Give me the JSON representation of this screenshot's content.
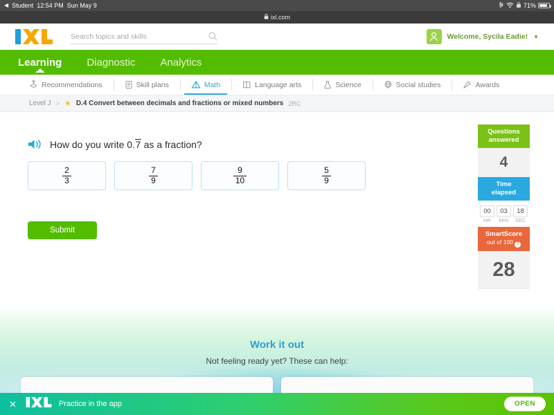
{
  "statusbar": {
    "back_glyph": "◀",
    "app_label": "Student",
    "time": "12:54 PM",
    "date": "Sun May 9",
    "bluetooth_icon": "bluetooth-icon",
    "wifi_icon": "wifi-icon",
    "lock_rotation_icon": "rotation-lock-icon",
    "battery_percent": "71%"
  },
  "browser": {
    "lock_glyph": "🔒",
    "url": "ixl.com"
  },
  "header": {
    "logo_text": "IXL",
    "logo_colors": {
      "i": "#1f9fda",
      "xl": "#f5a800"
    },
    "search": {
      "placeholder": "Search topics and skills",
      "value": "",
      "icon": "search-icon"
    },
    "user": {
      "avatar_icon": "user-avatar-icon",
      "greeting": "Welcome, Sycila Eadie!",
      "caret": "▼"
    }
  },
  "greennav": {
    "color": "#54bc00",
    "items": [
      {
        "label": "Learning",
        "active": true
      },
      {
        "label": "Diagnostic",
        "active": false
      },
      {
        "label": "Analytics",
        "active": false
      }
    ]
  },
  "subjects": {
    "accent": "#2aa8e0",
    "items": [
      {
        "label": "Recommendations",
        "icon": "recommendations-icon",
        "active": false
      },
      {
        "label": "Skill plans",
        "icon": "skill-plans-icon",
        "active": false
      },
      {
        "label": "Math",
        "icon": "math-icon",
        "active": true
      },
      {
        "label": "Language arts",
        "icon": "language-arts-icon",
        "active": false
      },
      {
        "label": "Science",
        "icon": "science-icon",
        "active": false
      },
      {
        "label": "Social studies",
        "icon": "social-studies-icon",
        "active": false
      },
      {
        "label": "Awards",
        "icon": "awards-icon",
        "active": false
      }
    ]
  },
  "breadcrumb": {
    "level": "Level J",
    "separator": ">",
    "star_icon": "star-icon",
    "skill_title": "D.4 Convert between decimals and fractions or mixed numbers",
    "skill_code": "2RC"
  },
  "question": {
    "speaker_icon": "speaker-icon",
    "prefix": "How do you write 0.",
    "repeating_digit": "7",
    "suffix": " as a fraction?",
    "choices": [
      {
        "numerator": "2",
        "denominator": "3",
        "selected": false
      },
      {
        "numerator": "7",
        "denominator": "9",
        "selected": false
      },
      {
        "numerator": "9",
        "denominator": "10",
        "selected": false
      },
      {
        "numerator": "5",
        "denominator": "9",
        "selected": false
      }
    ],
    "submit_label": "Submit"
  },
  "panel": {
    "questions": {
      "title_line1": "Questions",
      "title_line2": "answered",
      "value": "4",
      "color": "#7cc117"
    },
    "time": {
      "title_line1": "Time",
      "title_line2": "elapsed",
      "color": "#29a9e0",
      "hr": "00",
      "min": "03",
      "sec": "18",
      "hr_label": "HR",
      "min_label": "MIN",
      "sec_label": "SEC"
    },
    "smartscore": {
      "title": "SmartScore",
      "subtitle": "out of 100",
      "help_glyph": "?",
      "value": "28",
      "color": "#e8673c"
    }
  },
  "workitout": {
    "title": "Work it out",
    "subtitle": "Not feeling ready yet? These can help:",
    "cards": [
      {
        "text": ""
      },
      {
        "text": ""
      }
    ]
  },
  "appbanner": {
    "close_glyph": "✕",
    "logo_text": "IXL",
    "label": "Practice in the app",
    "open_label": "OPEN"
  }
}
